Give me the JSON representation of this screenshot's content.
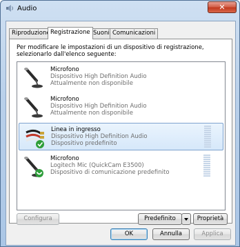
{
  "window": {
    "title": "Audio",
    "close_label": "✕"
  },
  "tabs": [
    {
      "label": "Riproduzione",
      "active": false
    },
    {
      "label": "Registrazione",
      "active": true
    },
    {
      "label": "Suoni",
      "active": false
    },
    {
      "label": "Comunicazioni",
      "active": false
    }
  ],
  "instructions": "Per modificare le impostazioni di un dispositivo di registrazione, selezionarlo dall'elenco seguente:",
  "devices": [
    {
      "name": "Microfono",
      "description": "Dispositivo High Definition Audio",
      "status": "Attualmente non disponibile",
      "icon": "microphone-icon",
      "selected": false
    },
    {
      "name": "Microfono",
      "description": "Dispositivo High Definition Audio",
      "status": "Attualmente non disponibile",
      "icon": "microphone-icon",
      "selected": false
    },
    {
      "name": "Linea in ingresso",
      "description": "Dispositivo High Definition Audio",
      "status": "Dispositivo predefinito",
      "icon": "line-in-cable-icon",
      "selected": true
    },
    {
      "name": "Microfono",
      "description": "Logitech Mic (QuickCam E3500)",
      "status": "Dispositivo di comunicazione predefinito",
      "icon": "microphone-icon",
      "selected": false
    }
  ],
  "buttons": {
    "configure": "Configura",
    "set_default": "Predefinito",
    "properties": "Proprietà",
    "ok": "OK",
    "cancel": "Annulla",
    "apply": "Applica"
  },
  "colors": {
    "accent": "#3c7fb1",
    "selection": "#d6e8fa",
    "default_check": "#2e9e3a"
  }
}
